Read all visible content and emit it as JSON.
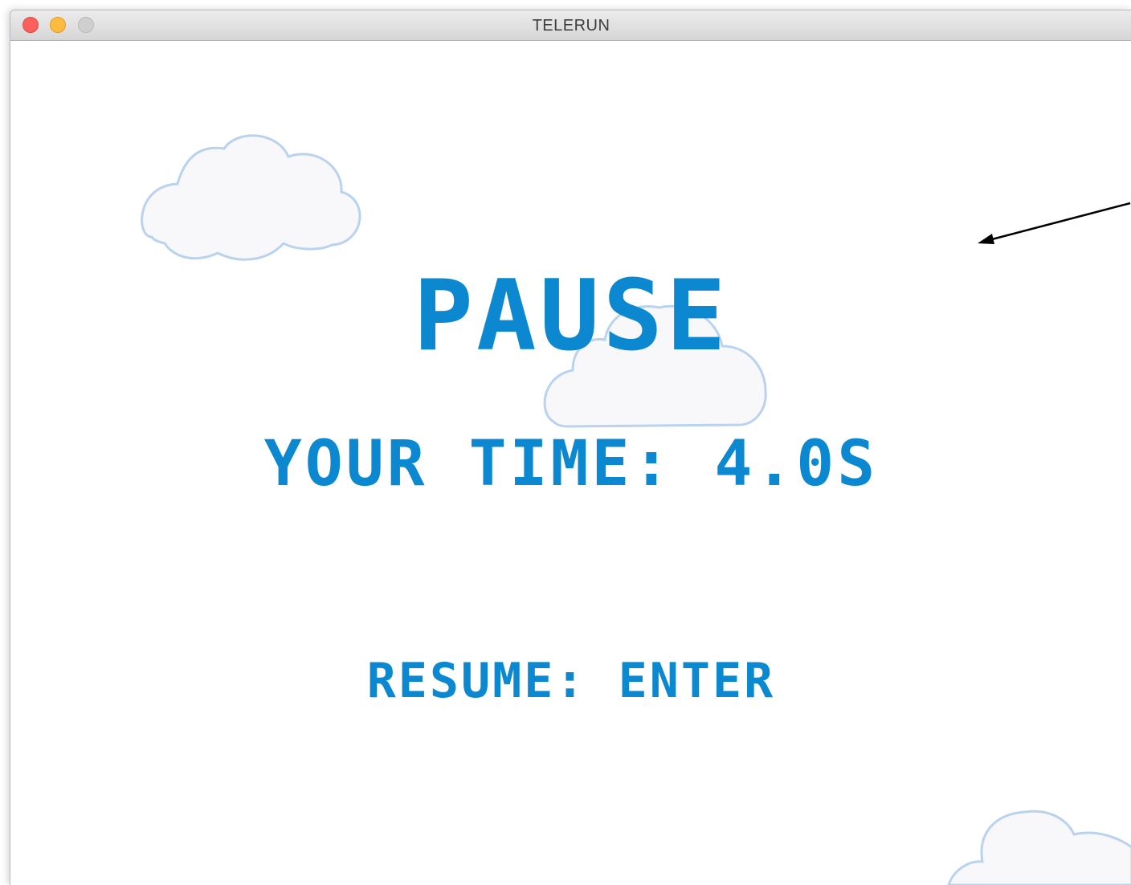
{
  "window": {
    "title": "TELERUN"
  },
  "game": {
    "pause_title": "PAUSE",
    "time_label": "YOUR TIME:",
    "time_value": "4.0S",
    "time_text": "YOUR TIME: 4.0S",
    "resume_text": "RESUME: ENTER"
  },
  "colors": {
    "text": "#0b88d0",
    "cloud_fill": "#f8f8fa",
    "cloud_outline": "#b9d3ef",
    "background": "#ffffff"
  },
  "icons": {
    "close": "traffic-close-icon",
    "minimize": "traffic-minimize-icon",
    "maximize": "traffic-maximize-icon",
    "cloud": "cloud-icon",
    "arrow": "annotation-arrow-icon"
  }
}
